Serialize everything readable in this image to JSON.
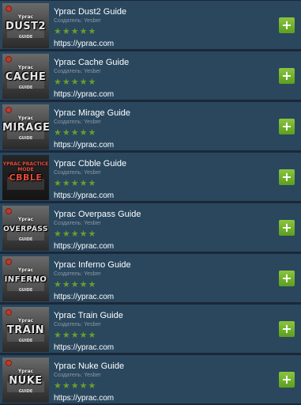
{
  "author_prefix": "Создатель: Yesber",
  "url": "https://yprac.com",
  "stars": "★★★★★",
  "add_label": "+",
  "items": [
    {
      "title": "Yprac Dust2 Guide",
      "thumb_brand": "Yprac",
      "thumb_title": "DUST2",
      "thumb_sub": "GUIDE"
    },
    {
      "title": "Yprac Cache Guide",
      "thumb_brand": "Yprac",
      "thumb_title": "CACHE",
      "thumb_sub": "GUIDE"
    },
    {
      "title": "Yprac Mirage Guide",
      "thumb_brand": "Yprac",
      "thumb_title": "MIRAGE",
      "thumb_sub": "GUIDE"
    },
    {
      "title": "Yprac Cbble Guide",
      "thumb_brand": "YPRAC PRACTICE MODE",
      "thumb_title": "CBBLE",
      "thumb_sub": ""
    },
    {
      "title": "Yprac Overpass Guide",
      "thumb_brand": "Yprac",
      "thumb_title": "OVERPASS",
      "thumb_sub": "GUIDE"
    },
    {
      "title": "Yprac Inferno Guide",
      "thumb_brand": "Yprac",
      "thumb_title": "INFERNO",
      "thumb_sub": "GUIDE"
    },
    {
      "title": "Yprac Train Guide",
      "thumb_brand": "Yprac",
      "thumb_title": "TRAIN",
      "thumb_sub": "GUIDE"
    },
    {
      "title": "Yprac Nuke Guide",
      "thumb_brand": "Yprac",
      "thumb_title": "NUKE",
      "thumb_sub": "GUIDE"
    }
  ]
}
